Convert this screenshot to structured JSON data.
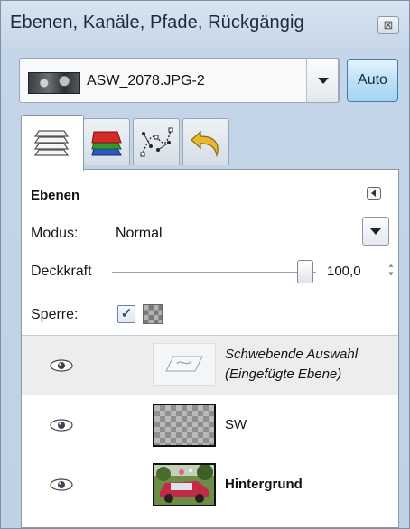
{
  "window": {
    "title": "Ebenen, Kanäle, Pfade, Rückgängig",
    "close_label": "⊠"
  },
  "image_selector": {
    "image_name": "ASW_2078.JPG-2",
    "auto_label": "Auto"
  },
  "tabs": [
    {
      "icon": "layers-icon",
      "active": true
    },
    {
      "icon": "channels-icon",
      "active": false
    },
    {
      "icon": "paths-icon",
      "active": false
    },
    {
      "icon": "undo-history-icon",
      "active": false
    }
  ],
  "layers_panel": {
    "title": "Ebenen",
    "mode_label": "Modus:",
    "mode_value": "Normal",
    "opacity_label": "Deckkraft",
    "opacity_value": "100,0",
    "opacity_fraction": 1.0,
    "lock_label": "Sperre:",
    "lock_pixels_checked": true
  },
  "layers": [
    {
      "name_line1": "Schwebende Auswahl",
      "name_line2": "(Eingefügte Ebene)",
      "visible": true,
      "selected": true,
      "thumb": "floating-selection-icon"
    },
    {
      "name_line1": "SW",
      "visible": true,
      "selected": false,
      "thumb": "transparent-checker"
    },
    {
      "name_line1": "Hintergrund",
      "visible": true,
      "selected": false,
      "thumb": "photo-thumbnail"
    }
  ],
  "colors": {
    "accent_auto": "#a6d3f3",
    "channel_red": "#d62a2a",
    "channel_green": "#2f9a2f",
    "channel_blue": "#2d56c9",
    "undo_yellow": "#e8b830"
  }
}
